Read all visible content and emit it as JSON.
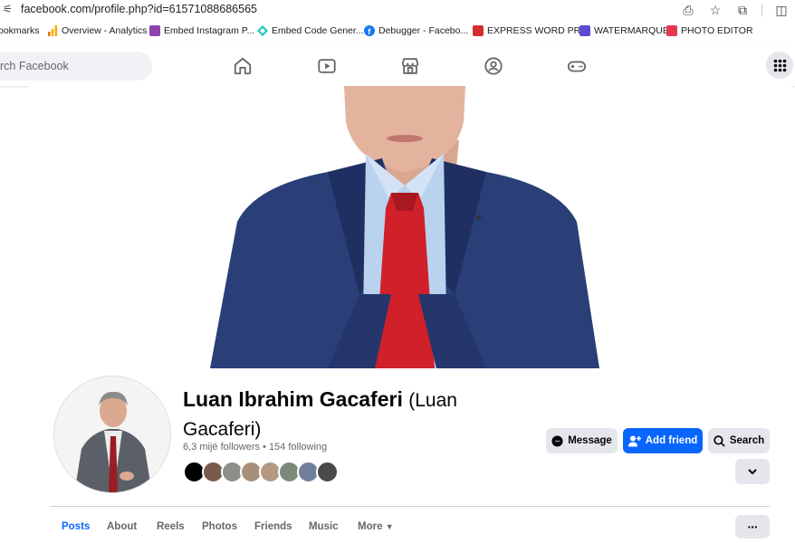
{
  "browser": {
    "url": "facebook.com/profile.php?id=61571088686565"
  },
  "bookmarks": [
    {
      "label": "ookmarks",
      "color": ""
    },
    {
      "label": "Overview - Analytics",
      "color": "#f9ab00"
    },
    {
      "label": "Embed Instagram P...",
      "color": "#8e44ad"
    },
    {
      "label": "Embed Code Gener...",
      "color": "#1ec8b4"
    },
    {
      "label": "Debugger - Facebo...",
      "color": "#1877f2"
    },
    {
      "label": "EXPRESS WORD PR...",
      "color": "#d32f2f"
    },
    {
      "label": "WATERMARQUE",
      "color": "#5b4bd6"
    },
    {
      "label": "PHOTO EDITOR",
      "color": "#e53950"
    }
  ],
  "nav": {
    "search_placeholder": "rch Facebook",
    "icons": [
      "home-icon",
      "video-icon",
      "marketplace-icon",
      "groups-icon",
      "gaming-icon"
    ],
    "menu_icon": "grid-menu-icon"
  },
  "profile": {
    "name": "Luan Ibrahim Gacaferi",
    "alternate_name": "(Luan Gacaferi)",
    "stats": "6,3 mijë followers • 154 following",
    "friend_count_shown": 8
  },
  "actions": {
    "message": "Message",
    "add_friend": "Add friend",
    "search": "Search"
  },
  "tabs": [
    "Posts",
    "About",
    "Reels",
    "Photos",
    "Friends",
    "Music",
    "More"
  ],
  "colors": {
    "accent": "#0866ff",
    "suit": "#2a3e78",
    "tie": "#d0202a",
    "shirt": "#b9d2ee"
  }
}
